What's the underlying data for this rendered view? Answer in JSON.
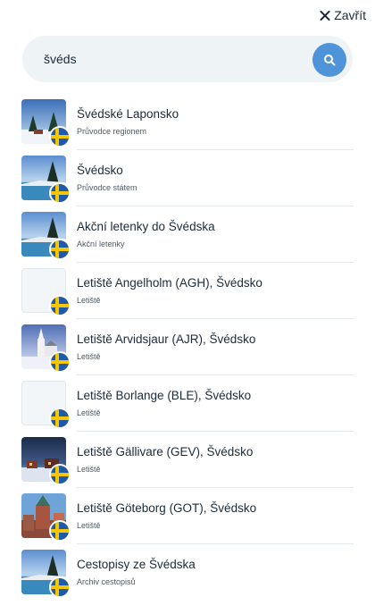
{
  "header": {
    "close_label": "Zavřít"
  },
  "search": {
    "value": "švéds",
    "placeholder": ""
  },
  "colors": {
    "accent": "#4f93d8",
    "flag_blue": "#1f5aa6",
    "flag_yellow": "#f7c600"
  },
  "results": [
    {
      "title": "Švédské Laponsko",
      "subtitle": "Průvodce regionem",
      "thumb": "winter-forest"
    },
    {
      "title": "Švédsko",
      "subtitle": "Průvodce státem",
      "thumb": "lake-winter"
    },
    {
      "title": "Akční letenky do Švédska",
      "subtitle": "Akční letenky",
      "thumb": "lake-winter"
    },
    {
      "title": "Letiště Angelholm (AGH), Švédsko",
      "subtitle": "Letiště",
      "thumb": "blank"
    },
    {
      "title": "Letiště Arvidsjaur (AJR), Švédsko",
      "subtitle": "Letiště",
      "thumb": "church-snow"
    },
    {
      "title": "Letiště Borlange (BLE), Švédsko",
      "subtitle": "Letiště",
      "thumb": "blank"
    },
    {
      "title": "Letiště Gällivare (GEV), Švédsko",
      "subtitle": "Letiště",
      "thumb": "night-village"
    },
    {
      "title": "Letiště Göteborg (GOT), Švédsko",
      "subtitle": "Letiště",
      "thumb": "church-city"
    },
    {
      "title": "Cestopisy ze Švédska",
      "subtitle": "Archiv cestopisů",
      "thumb": "lake-winter"
    }
  ]
}
